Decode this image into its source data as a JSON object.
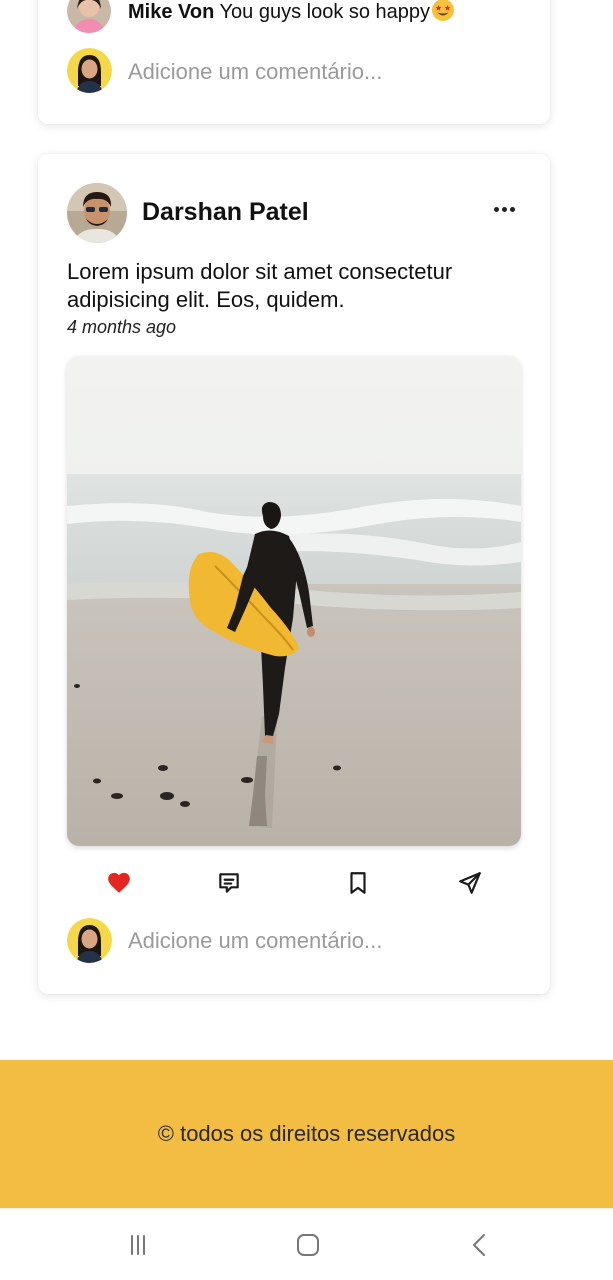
{
  "top_card": {
    "comment": {
      "author": "Mike Von",
      "text": "You guys look so happy",
      "emoji_icon": "star-struck-emoji-icon"
    },
    "add_comment_placeholder": "Adicione um comentário..."
  },
  "post": {
    "author": "Darshan Patel",
    "menu_icon": "more-horizontal-icon",
    "text": "Lorem ipsum dolor sit amet consectetur adipisicing elit. Eos, quidem.",
    "time": "4 months ago",
    "image_alt": "Surfer walking on beach carrying a yellow surfboard",
    "actions": {
      "like_icon": "heart-icon",
      "comment_icon": "comment-icon",
      "save_icon": "bookmark-icon",
      "share_icon": "send-icon"
    },
    "liked": true,
    "add_comment_placeholder": "Adicione um comentário..."
  },
  "footer": {
    "text": "© todos os direitos reservados"
  },
  "system_nav": {
    "recents_icon": "recents-icon",
    "home_icon": "home-icon",
    "back_icon": "back-icon"
  },
  "colors": {
    "footer_bg": "#f2bd42",
    "like_red": "#e52620",
    "placeholder_gray": "#9a9a9a",
    "avatar_yellow": "#f4d84a"
  }
}
